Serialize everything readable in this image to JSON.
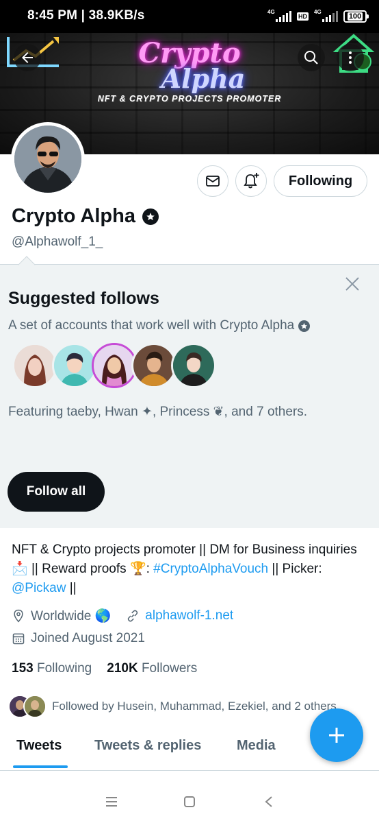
{
  "status_bar": {
    "time": "8:45 PM | 38.9KB/s",
    "network1": "4G",
    "hd": "HD",
    "network2": "4G",
    "battery": "100"
  },
  "banner": {
    "title_line1": "Crypto",
    "title_line2": "Alpha",
    "tagline": "NFT & CRYPTO PROJECTS PROMOTER",
    "colors": {
      "pink_neon": "#ff3ee8",
      "blue_neon": "#3443ff"
    }
  },
  "header": {
    "back_icon": "arrow-left-icon",
    "search_icon": "search-icon",
    "more_icon": "more-vertical-icon"
  },
  "profile": {
    "name": "Crypto Alpha",
    "handle": "@Alphawolf_1_",
    "following_button": "Following",
    "bio_text_1": "NFT & Crypto projects promoter || DM for Business inquiries ",
    "bio_emoji_1": "📩",
    "bio_text_2": " || Reward proofs ",
    "bio_emoji_2": "🏆",
    "bio_text_3": ": ",
    "bio_hashtag": "#CryptoAlphaVouch",
    "bio_text_4": " || Picker: ",
    "bio_mention": "@Pickaw",
    "bio_text_5": " ||",
    "location": "Worldwide 🌎",
    "website": "alphawolf-1.net",
    "joined": "Joined August 2021",
    "following_count": "153",
    "following_label": "Following",
    "followers_count": "210K",
    "followers_label": "Followers",
    "followed_by": "Followed by Husein, Muhammad, Ezekiel, and 2 others"
  },
  "suggested": {
    "title": "Suggested follows",
    "subtitle": "A set of accounts that work well with Crypto Alpha",
    "featuring": "Featuring taeby, Hwan ✦, Princess ❦, and 7 others.",
    "follow_all": "Follow all"
  },
  "tabs": [
    {
      "label": "Tweets"
    },
    {
      "label": "Tweets & replies"
    },
    {
      "label": "Media"
    }
  ],
  "colors": {
    "accent": "#1d9bf0",
    "text": "#0f1419",
    "muted": "#536471",
    "panel_bg": "#eff3f4"
  }
}
